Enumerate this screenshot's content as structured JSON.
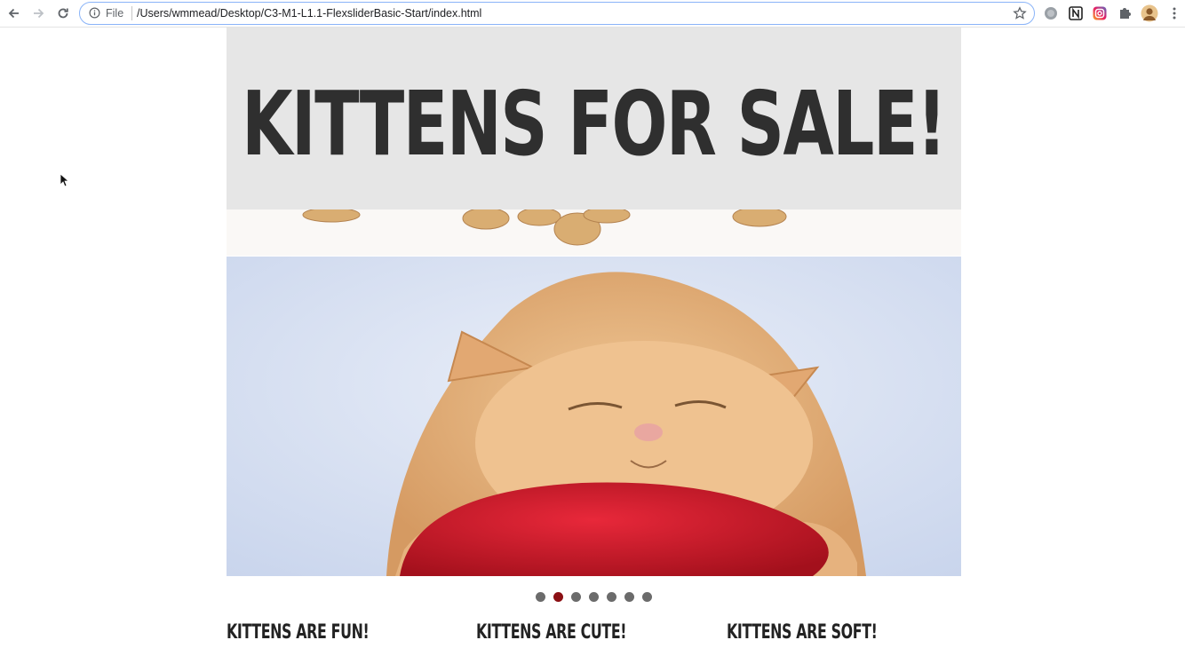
{
  "browser": {
    "nav": {
      "back_icon": "arrow-left-icon",
      "forward_icon": "arrow-right-icon",
      "reload_icon": "reload-icon"
    },
    "omnibox": {
      "scheme_label": "File",
      "url": "/Users/wmmead/Desktop/C3-M1-L1.1-FlexsliderBasic-Start/index.html"
    },
    "extensions": [
      "circle-extension-icon",
      "notion-icon",
      "instagram-icon",
      "puzzle-extensions-icon",
      "profile-avatar",
      "kebab-menu-icon"
    ]
  },
  "page": {
    "hero_title": "KITTENS FOR SALE!",
    "slider": {
      "slide_count": 7,
      "active_index": 1,
      "slide_description_icon": "sleeping-kitten-image"
    },
    "features": [
      {
        "title": "KITTENS ARE FUN!"
      },
      {
        "title": "KITTENS ARE CUTE!"
      },
      {
        "title": "KITTENS ARE SOFT!"
      }
    ]
  },
  "colors": {
    "hero_bg": "#e6e6e6",
    "hero_text": "#2f2f2f",
    "dot_active": "#8b1014",
    "dot_inactive": "#6b6b6b",
    "omnibox_border": "#8ab4f8"
  }
}
